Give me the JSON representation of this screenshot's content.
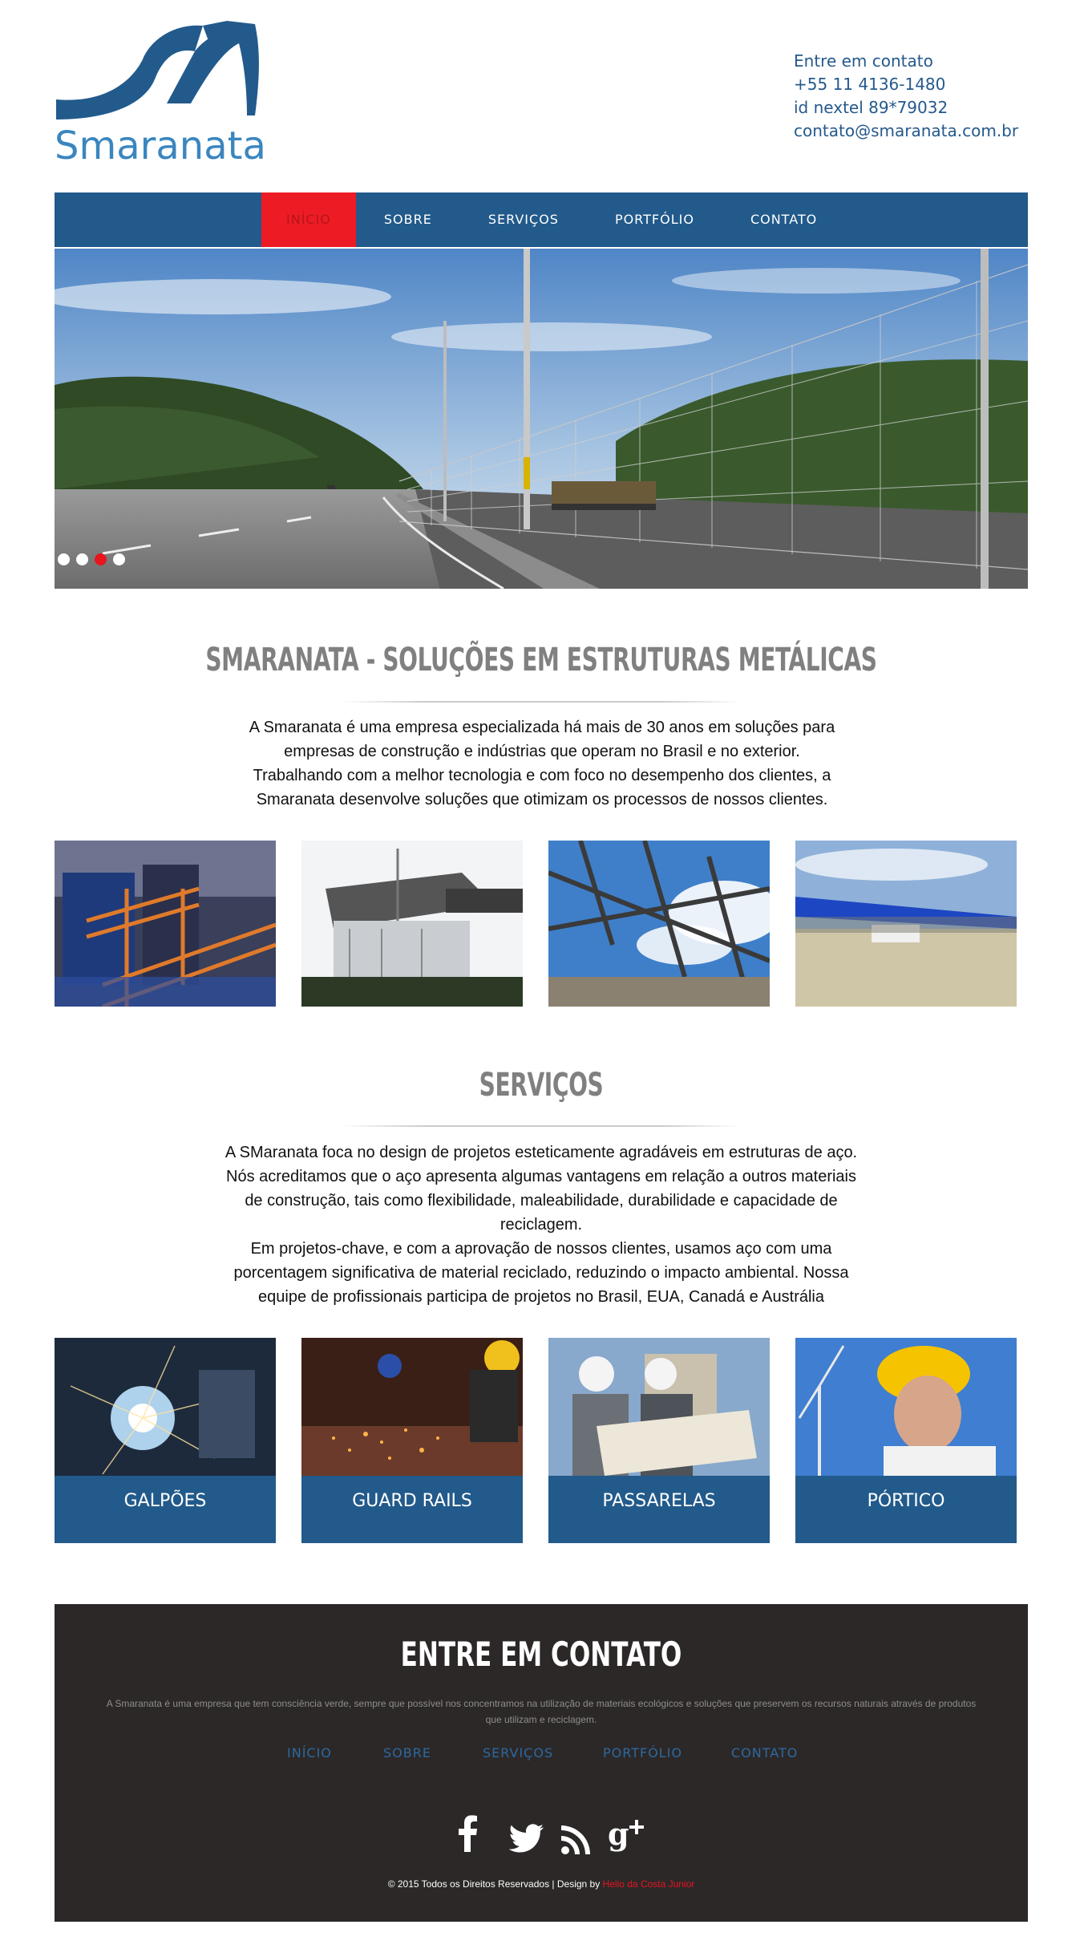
{
  "header": {
    "logo_text": "Smaranata",
    "contact": {
      "heading": "Entre em contato",
      "phone": "+55 11 4136-1480",
      "nextel": "id nextel 89*79032",
      "email": "contato@smaranata.com.br"
    }
  },
  "nav": {
    "items": [
      "INÍCIO",
      "SOBRE",
      "SERVIÇOS",
      "PORTFÓLIO",
      "CONTATO"
    ],
    "active": "INÍCIO"
  },
  "slider": {
    "slides": 4,
    "active_index": 2
  },
  "about": {
    "title": "SMARANATA - SOLUÇÕES EM ESTRUTURAS METÁLICAS",
    "text": "A Smaranata é uma empresa especializada há mais de 30 anos em soluções para empresas de construção e indústrias que operam no Brasil e no exterior. Trabalhando com a melhor tecnologia e com foco no desempenho dos clientes, a Smaranata desenvolve soluções que otimizam os processos de nossos clientes."
  },
  "services": {
    "title": "SERVIÇOS",
    "text1": "A SMaranata foca no design de projetos esteticamente agradáveis em estruturas de aço. Nós acreditamos que o aço apresenta algumas vantagens em relação a outros materiais de construção, tais como flexibilidade, maleabilidade, durabilidade e capacidade de reciclagem.",
    "text2": "Em projetos-chave, e com a aprovação de nossos clientes, usamos aço com uma porcentagem significativa de material reciclado, reduzindo o impacto ambiental. Nossa equipe de profissionais participa de projetos no Brasil, EUA, Canadá e Austrália",
    "cards": [
      "GALPÕES",
      "GUARD RAILS",
      "PASSARELAS",
      "PÓRTICO"
    ]
  },
  "footer": {
    "title": "ENTRE EM CONTATO",
    "text": "A Smaranata é uma empresa que tem consciência verde, sempre que possível nos concentramos na utilização de materiais ecológicos e soluções que preservem os recursos naturais através de produtos que utilizam e reciclagem.",
    "nav": [
      "INÍCIO",
      "SOBRE",
      "SERVIÇOS",
      "PORTFÓLIO",
      "CONTATO"
    ],
    "social_icons": [
      "facebook-icon",
      "twitter-icon",
      "rss-icon",
      "google-plus-icon"
    ],
    "copyright": "© 2015 Todos os Direitos Reservados | Design by",
    "author": "Helio da Costa Junior"
  },
  "colors": {
    "brand_blue": "#225a8b",
    "accent_red": "#ed1c24",
    "footer_bg": "#2c2828",
    "heading_gray": "#808080"
  }
}
